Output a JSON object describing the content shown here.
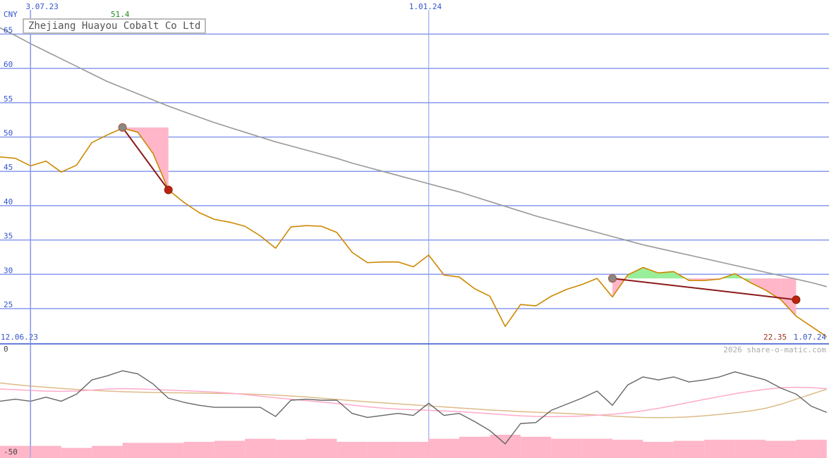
{
  "chart_data": [
    {
      "type": "line",
      "title": "Zhejiang Huayou Cobalt Co Ltd",
      "ylabel": "CNY",
      "ylim": [
        19.5,
        68
      ],
      "y_ticks": [
        25,
        30,
        35,
        40,
        45,
        50,
        55,
        60,
        65
      ],
      "x_top_labels": [
        {
          "label": "3.07.23",
          "x": 1.5
        },
        {
          "label": "1.01.24",
          "x": 27.5
        }
      ],
      "x_bottom_labels": [
        {
          "label": "12.06.23",
          "x": 0
        },
        {
          "label": "1.07.24",
          "x": 53
        }
      ],
      "max_label": "51.4",
      "min_label": "22.35",
      "watermark": "2026 share-o-matic.com",
      "grid": true,
      "colors": {
        "price": "#cc8800",
        "ma": "#999999",
        "grid": "#8899ee",
        "loss": "#ffb6c8",
        "gain": "#99ee99",
        "trend": "#8b1a1a",
        "axis": "#3355cc"
      },
      "series": [
        {
          "key": "price",
          "x": [
            0,
            1,
            2,
            3,
            4,
            5,
            6,
            7,
            8,
            9,
            10,
            11,
            12,
            13,
            14,
            15,
            16,
            17,
            18,
            19,
            20,
            21,
            22,
            23,
            24,
            25,
            26,
            27,
            28,
            29,
            30,
            31,
            32,
            33,
            34,
            35,
            36,
            37,
            38,
            39,
            40,
            41,
            42,
            43,
            44,
            45,
            46,
            47,
            48,
            49,
            50,
            51,
            52,
            53,
            54
          ],
          "values": [
            47.1,
            46.9,
            45.8,
            46.5,
            44.9,
            45.9,
            49.2,
            50.3,
            51.3,
            50.7,
            47.6,
            42.3,
            40.5,
            39.0,
            38.0,
            37.6,
            37.0,
            35.6,
            33.8,
            36.9,
            37.1,
            37.0,
            36.1,
            33.2,
            31.7,
            31.8,
            31.8,
            31.1,
            32.8,
            29.9,
            29.6,
            27.9,
            26.8,
            22.4,
            25.6,
            25.4,
            26.8,
            27.8,
            28.5,
            29.4,
            26.7,
            29.9,
            31.0,
            30.2,
            30.4,
            29.1,
            29.1,
            29.3,
            30.1,
            28.8,
            27.7,
            26.3,
            23.9,
            22.4,
            20.9
          ]
        },
        {
          "key": "ma",
          "x": [
            0,
            1,
            2,
            3,
            4,
            5,
            6,
            7,
            8,
            9,
            10,
            11,
            12,
            13,
            14,
            15,
            16,
            17,
            18,
            19,
            20,
            21,
            22,
            23,
            24,
            25,
            26,
            27,
            28,
            29,
            30,
            31,
            32,
            33,
            34,
            35,
            36,
            37,
            38,
            39,
            40,
            41,
            42,
            43,
            44,
            45,
            46,
            47,
            48,
            49,
            50,
            51,
            52,
            53,
            54
          ],
          "values": [
            65.9,
            64.8,
            63.6,
            62.5,
            61.4,
            60.3,
            59.2,
            58.1,
            57.2,
            56.3,
            55.4,
            54.5,
            53.7,
            52.9,
            52.1,
            51.4,
            50.7,
            50.0,
            49.3,
            48.7,
            48.1,
            47.5,
            46.9,
            46.2,
            45.6,
            45.0,
            44.4,
            43.8,
            43.2,
            42.6,
            42.0,
            41.3,
            40.6,
            39.9,
            39.2,
            38.5,
            37.9,
            37.3,
            36.7,
            36.1,
            35.5,
            34.9,
            34.3,
            33.8,
            33.3,
            32.8,
            32.3,
            31.8,
            31.3,
            30.8,
            30.3,
            29.8,
            29.3,
            28.8,
            28.2
          ]
        }
      ],
      "trend_segments": [
        {
          "from": [
            8,
            51.4
          ],
          "to": [
            11,
            42.3
          ]
        },
        {
          "from": [
            40,
            29.4
          ],
          "to": [
            52,
            26.3
          ]
        }
      ]
    },
    {
      "type": "line",
      "ylim": [
        -50,
        0
      ],
      "y_ticks_labels": [
        "0",
        "-50"
      ],
      "series": [
        {
          "key": "osc",
          "x": [
            0,
            1,
            2,
            3,
            4,
            5,
            6,
            7,
            8,
            9,
            10,
            11,
            12,
            13,
            14,
            15,
            16,
            17,
            18,
            19,
            20,
            21,
            22,
            23,
            24,
            25,
            26,
            27,
            28,
            29,
            30,
            31,
            32,
            33,
            34,
            35,
            36,
            37,
            38,
            39,
            40,
            41,
            42,
            43,
            44,
            45,
            46,
            47,
            48,
            49,
            50,
            51,
            52,
            53,
            54
          ],
          "values": [
            -25.5,
            -24.5,
            -25.5,
            -23.5,
            -25.5,
            -22.0,
            -15.0,
            -13.0,
            -10.5,
            -12.0,
            -17.0,
            -24.0,
            -26.0,
            -27.5,
            -28.5,
            -28.5,
            -28.5,
            -28.5,
            -33.0,
            -25.0,
            -24.5,
            -25.0,
            -25.0,
            -31.5,
            -33.5,
            -32.5,
            -31.5,
            -32.5,
            -26.5,
            -32.5,
            -31.5,
            -35.5,
            -40.0,
            -46.5,
            -36.5,
            -36.0,
            -30.0,
            -27.0,
            -24.0,
            -20.5,
            -27.5,
            -17.5,
            -13.5,
            -15.0,
            -13.5,
            -16.0,
            -15.0,
            -13.5,
            -11.0,
            -13.0,
            -15.0,
            -19.0,
            -22.0,
            -28.0,
            -31.0
          ]
        },
        {
          "key": "fast",
          "x": [
            0,
            1,
            2,
            3,
            4,
            5,
            6,
            7,
            8,
            9,
            10,
            11,
            12,
            13,
            14,
            15,
            16,
            17,
            18,
            19,
            20,
            21,
            22,
            23,
            24,
            25,
            26,
            27,
            28,
            29,
            30,
            31,
            32,
            33,
            34,
            35,
            36,
            37,
            38,
            39,
            40,
            41,
            42,
            43,
            44,
            45,
            46,
            47,
            48,
            49,
            50,
            51,
            52,
            53,
            54
          ],
          "values": [
            -19.5,
            -19.8,
            -20.2,
            -20.5,
            -20.6,
            -20.5,
            -20.0,
            -19.5,
            -19.3,
            -19.4,
            -19.7,
            -20.0,
            -20.3,
            -20.6,
            -21.0,
            -21.5,
            -22.2,
            -23.0,
            -23.8,
            -24.5,
            -25.2,
            -25.9,
            -26.6,
            -27.4,
            -28.2,
            -28.9,
            -29.4,
            -29.7,
            -30.0,
            -30.3,
            -30.6,
            -31.1,
            -31.6,
            -32.2,
            -32.7,
            -33.0,
            -33.1,
            -33.0,
            -32.8,
            -32.4,
            -31.9,
            -31.2,
            -30.2,
            -29.0,
            -27.6,
            -26.1,
            -24.6,
            -23.2,
            -21.8,
            -20.6,
            -19.6,
            -18.9,
            -18.6,
            -18.8,
            -19.3
          ]
        },
        {
          "key": "slow",
          "x": [
            0,
            1,
            2,
            3,
            4,
            5,
            6,
            7,
            8,
            9,
            10,
            11,
            12,
            13,
            14,
            15,
            16,
            17,
            18,
            19,
            20,
            21,
            22,
            23,
            24,
            25,
            26,
            27,
            28,
            29,
            30,
            31,
            32,
            33,
            34,
            35,
            36,
            37,
            38,
            39,
            40,
            41,
            42,
            43,
            44,
            45,
            46,
            47,
            48,
            49,
            50,
            51,
            52,
            53,
            54
          ],
          "values": [
            -16.5,
            -17.3,
            -18.0,
            -18.6,
            -19.2,
            -19.7,
            -20.1,
            -20.5,
            -20.8,
            -21.0,
            -21.2,
            -21.3,
            -21.4,
            -21.5,
            -21.6,
            -21.7,
            -21.9,
            -22.2,
            -22.5,
            -22.9,
            -23.4,
            -24.0,
            -24.6,
            -25.2,
            -25.8,
            -26.3,
            -26.8,
            -27.3,
            -27.8,
            -28.3,
            -28.8,
            -29.3,
            -29.8,
            -30.2,
            -30.6,
            -30.9,
            -31.2,
            -31.5,
            -31.9,
            -32.3,
            -32.8,
            -33.2,
            -33.5,
            -33.6,
            -33.5,
            -33.2,
            -32.7,
            -32.0,
            -31.2,
            -30.3,
            -29.0,
            -27.0,
            -24.5,
            -22.0,
            -19.5
          ]
        },
        {
          "key": "volume",
          "type": "bar",
          "x": [
            0,
            2,
            4,
            6,
            8,
            10,
            12,
            14,
            16,
            18,
            20,
            22,
            24,
            26,
            28,
            30,
            32,
            34,
            36,
            38,
            40,
            42,
            44,
            46,
            48,
            50,
            52
          ],
          "values": [
            -47.5,
            -47.5,
            -48.5,
            -47.5,
            -46.0,
            -46.0,
            -45.5,
            -45.0,
            -44.0,
            -44.5,
            -44.0,
            -45.5,
            -45.5,
            -45.5,
            -44.0,
            -43.0,
            -42.0,
            -43.0,
            -44.0,
            -44.0,
            -44.5,
            -45.5,
            -45.0,
            -44.5,
            -44.5,
            -45.0,
            -44.5
          ]
        }
      ],
      "colors": {
        "osc": "#666666",
        "fast": "#ffaacc",
        "slow": "#ddbb88",
        "volume": "#ffb6c8"
      }
    }
  ]
}
